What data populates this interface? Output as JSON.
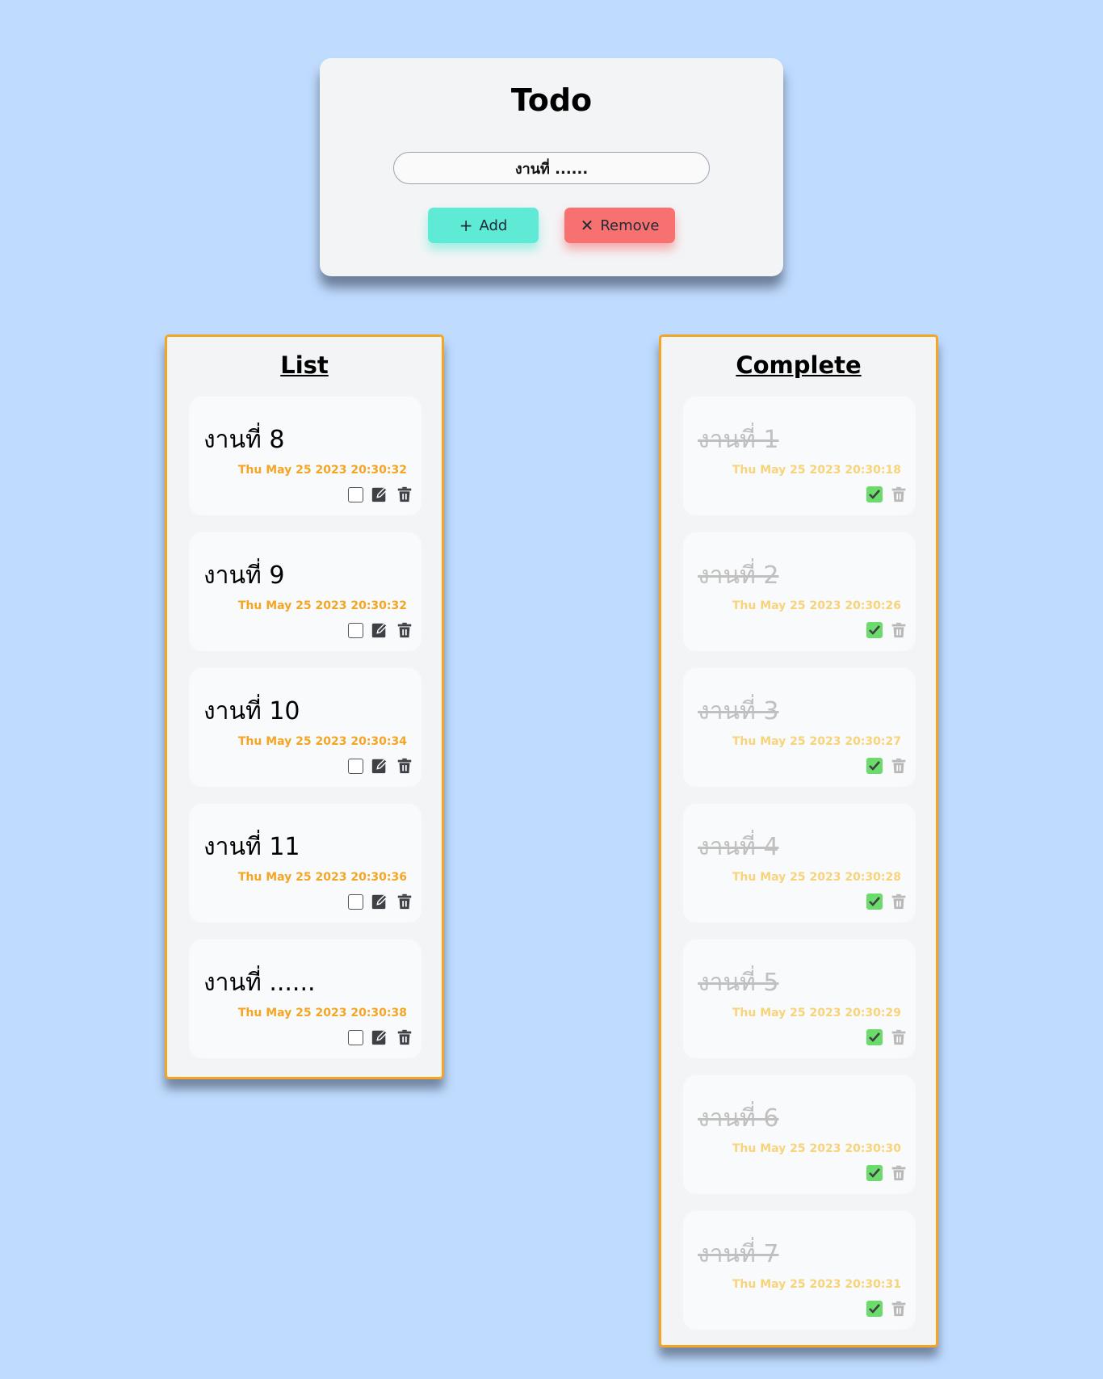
{
  "header": {
    "title": "Todo",
    "input_value": "งานที่ ......",
    "add_label": "Add",
    "remove_label": "Remove"
  },
  "list": {
    "heading": "List",
    "items": [
      {
        "name": "งานที่ 8",
        "date": "Thu May 25 2023 20:30:32"
      },
      {
        "name": "งานที่ 9",
        "date": "Thu May 25 2023 20:30:32"
      },
      {
        "name": "งานที่ 10",
        "date": "Thu May 25 2023 20:30:34"
      },
      {
        "name": "งานที่ 11",
        "date": "Thu May 25 2023 20:30:36"
      },
      {
        "name": "งานที่ ......",
        "date": "Thu May 25 2023 20:30:38"
      }
    ]
  },
  "complete": {
    "heading": "Complete",
    "items": [
      {
        "name": "งานที่ 1",
        "date": "Thu May 25 2023 20:30:18"
      },
      {
        "name": "งานที่ 2",
        "date": "Thu May 25 2023 20:30:26"
      },
      {
        "name": "งานที่ 3",
        "date": "Thu May 25 2023 20:30:27"
      },
      {
        "name": "งานที่ 4",
        "date": "Thu May 25 2023 20:30:28"
      },
      {
        "name": "งานที่ 5",
        "date": "Thu May 25 2023 20:30:29"
      },
      {
        "name": "งานที่ 6",
        "date": "Thu May 25 2023 20:30:30"
      },
      {
        "name": "งานที่ 7",
        "date": "Thu May 25 2023 20:30:31"
      }
    ]
  },
  "icons": {
    "add": "plus-icon",
    "remove": "close-icon",
    "edit": "edit-icon",
    "delete": "trash-icon",
    "checked": "checkmark-icon"
  },
  "colors": {
    "background": "#bfdbfe",
    "accent": "#f5a524",
    "add_button": "#5eead4",
    "remove_button": "#f87171",
    "checked": "#6bdc6b"
  }
}
